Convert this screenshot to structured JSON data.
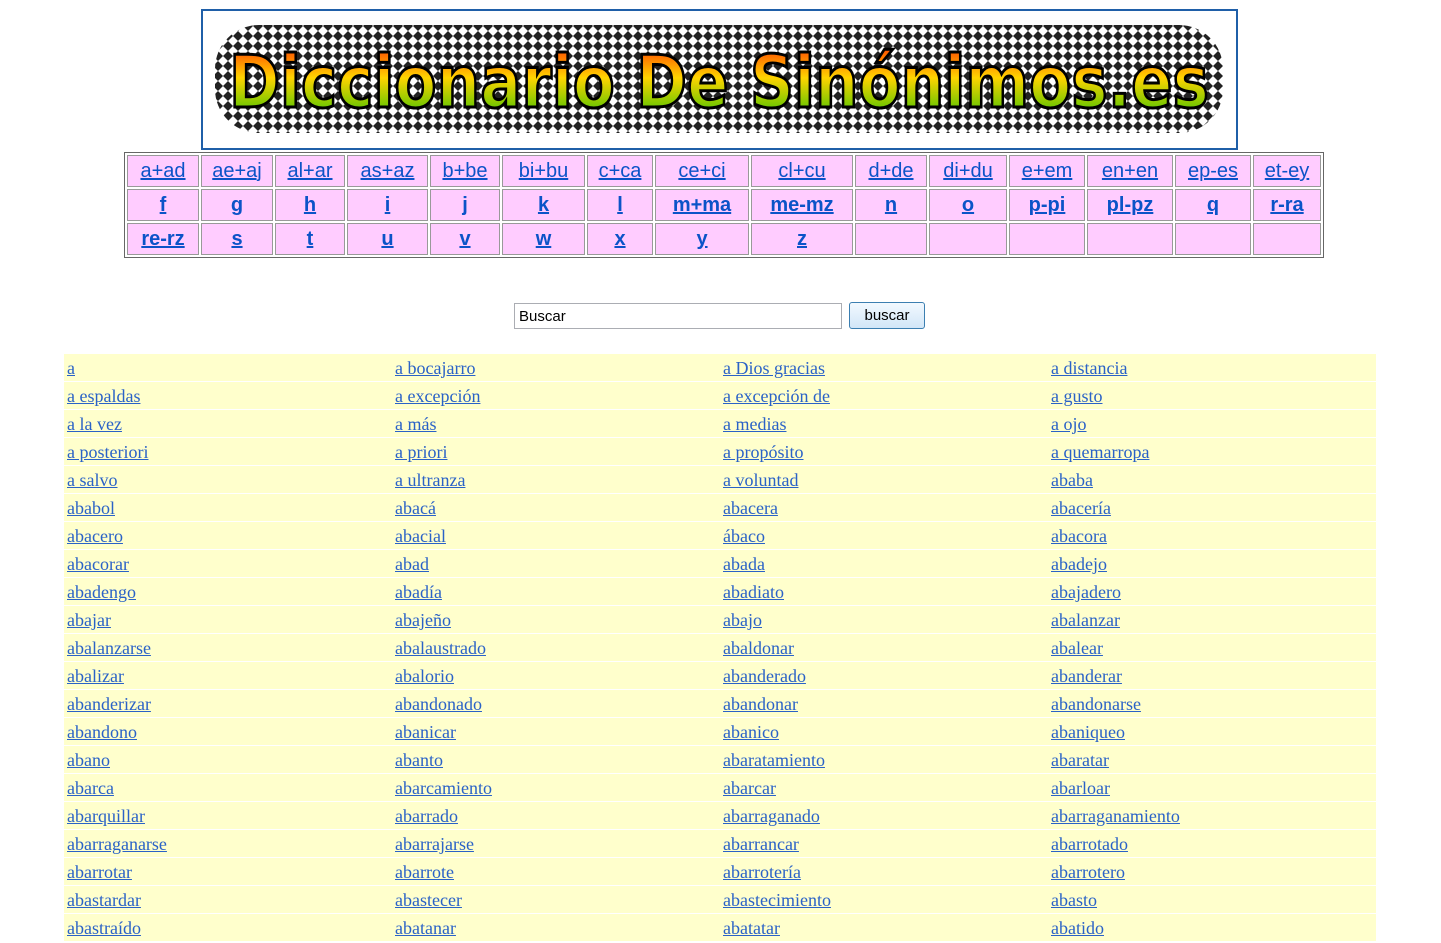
{
  "header": {
    "logo_text": "Diccionario De Sinónimos.es"
  },
  "nav": {
    "rows": [
      [
        "a+ad",
        "ae+aj",
        "al+ar",
        "as+az",
        "b+be",
        "bi+bu",
        "c+ca",
        "ce+ci",
        "cl+cu",
        "d+de",
        "di+du",
        "e+em",
        "en+en",
        "ep-es",
        "et-ey"
      ],
      [
        "f",
        "g",
        "h",
        "i",
        "j",
        "k",
        "l",
        "m+ma",
        "me-mz",
        "n",
        "o",
        "p-pi",
        "pl-pz",
        "q",
        "r-ra"
      ],
      [
        "re-rz",
        "s",
        "t",
        "u",
        "v",
        "w",
        "x",
        "y",
        "z",
        "",
        "",
        "",
        "",
        "",
        ""
      ]
    ]
  },
  "search": {
    "value": "Buscar",
    "button_label": "buscar"
  },
  "words": [
    "a",
    "a bocajarro",
    "a Dios gracias",
    "a distancia",
    "a espaldas",
    "a excepción",
    "a excepción de",
    "a gusto",
    "a la vez",
    "a más",
    "a medias",
    "a ojo",
    "a posteriori",
    "a priori",
    "a propósito",
    "a quemarropa",
    "a salvo",
    "a ultranza",
    "a voluntad",
    "ababa",
    "ababol",
    "abacá",
    "abacera",
    "abacería",
    "abacero",
    "abacial",
    "ábaco",
    "abacora",
    "abacorar",
    "abad",
    "abada",
    "abadejo",
    "abadengo",
    "abadía",
    "abadiato",
    "abajadero",
    "abajar",
    "abajeño",
    "abajo",
    "abalanzar",
    "abalanzarse",
    "abalaustrado",
    "abaldonar",
    "abalear",
    "abalizar",
    "abalorio",
    "abanderado",
    "abanderar",
    "abanderizar",
    "abandonado",
    "abandonar",
    "abandonarse",
    "abandono",
    "abanicar",
    "abanico",
    "abaniqueo",
    "abano",
    "abanto",
    "abaratamiento",
    "abaratar",
    "abarca",
    "abarcamiento",
    "abarcar",
    "abarloar",
    "abarquillar",
    "abarrado",
    "abarraganado",
    "abarraganamiento",
    "abarraganarse",
    "abarrajarse",
    "abarrancar",
    "abarrotado",
    "abarrotar",
    "abarrote",
    "abarrotería",
    "abarrotero",
    "abastardar",
    "abastecer",
    "abastecimiento",
    "abasto",
    "abastraído",
    "abatanar",
    "abatatar",
    "abatido"
  ]
}
